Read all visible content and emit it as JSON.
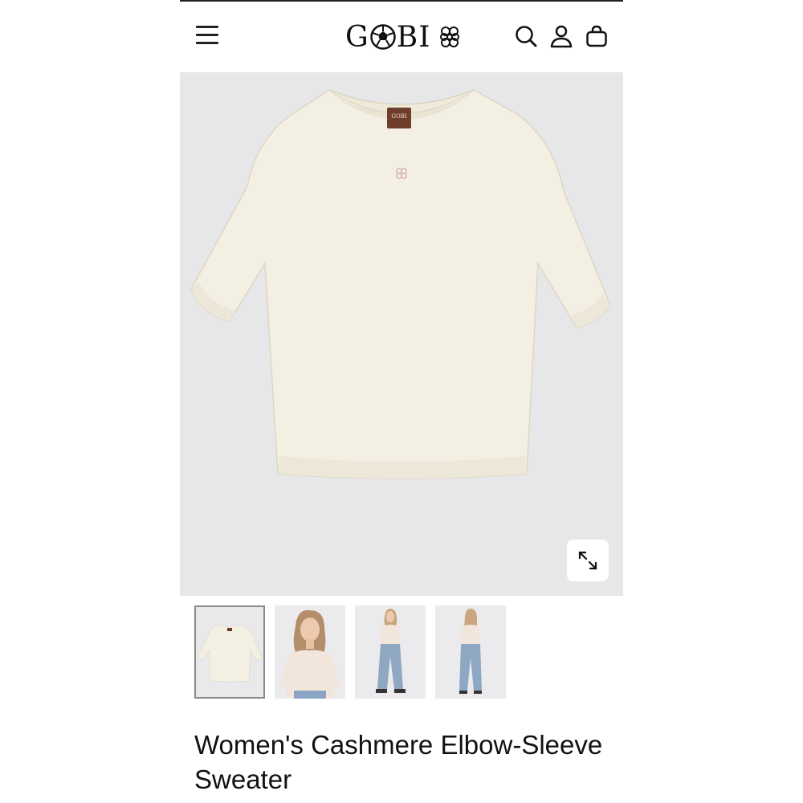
{
  "header": {
    "brand": "GOBI",
    "icons": [
      "menu-icon",
      "soccer-ball-logo",
      "clover-logo",
      "search-icon",
      "account-icon",
      "bag-icon"
    ]
  },
  "product": {
    "title": "Women's Cashmere Elbow-Sleeve Sweater",
    "color": "#f3efe2",
    "label_text": "GOBI",
    "thumbnails": [
      {
        "name": "flat-lay",
        "active": true
      },
      {
        "name": "model-front-closeup",
        "active": false
      },
      {
        "name": "model-full-front",
        "active": false
      },
      {
        "name": "model-full-back",
        "active": false
      }
    ]
  },
  "colors": {
    "hero_bg": "#e7e7ea",
    "text": "#111111",
    "active_thumb_border": "#8a8a8a"
  }
}
